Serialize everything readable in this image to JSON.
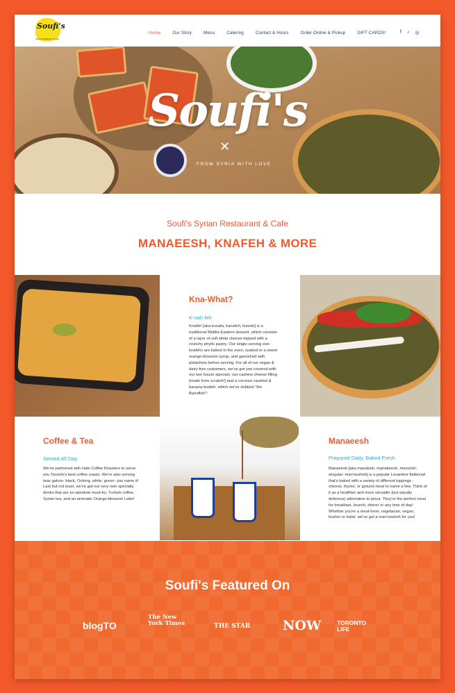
{
  "nav": {
    "logo_text": "Soufi's",
    "logo_sub": "Syrian Restaurant & Cafe",
    "items": [
      "Home",
      "Our Story",
      "Menu",
      "Catering",
      "Contact & Hours",
      "Order Online & Pickup",
      "GIFT CARDS!"
    ],
    "active": "Home",
    "social": [
      "f",
      "♪",
      "◎"
    ]
  },
  "hero": {
    "title": "Soufi's",
    "cross": "✕",
    "subtitle": "FROM SYRIA WITH LOVE"
  },
  "intro": {
    "subtitle": "Soufi's Syrian Restaurant & Cafe",
    "title": "MANAEESH, KNAFEH & MORE"
  },
  "knafeh": {
    "title": "Kna-What?",
    "subtitle": "K-nah-feh",
    "body": "Knafeh [aka kunafa, kanafeh, kunefe] is a traditional Middle-Eastern dessert, which consists of a layer of soft white cheese topped with a crunchy phyllo pastry. Our single-serving size knafehs are baked in the oven, soaked in a sweet orange-blossom syrup, and garnished with pistachios before serving. For all of our vegan & dairy-free customers, we've got you covered with our two house specials: our cashew cheese filling [made from scratch!] and a coconut caramel & banana knafeh, which we've dubbed \"the Banoffeh\"!"
  },
  "coffee": {
    "title": "Coffee & Tea",
    "subtitle": "Served All Day",
    "body": "We've partnered with Hale Coffee Roasters to serve you Toronto's best coffee roasts. We're also serving teas galore- black, Oolong, white, green- you name it! Last but not least, we've got our very own specialty drinks that are an absolute must-try: Turkish coffee, Syrian tea, and an aromatic Orange-blossom Latte!"
  },
  "manaeesh": {
    "title": "Manaeesh",
    "subtitle": "Prepared Daily, Baked Fresh",
    "body": "Manaeesh [aka manakish, manakeesh, mana'ish; singular: man'oosheh] is a popular Levantine flatbread that's baked with a variety of different toppings - cheese, thyme, or ground meat to name a few. Think of it as a healthier and more versatile (but equally delicious) alternative to pizza. They're the perfect meal for breakfast, brunch, dinner or any time of day! Whether you're a meat-lover, vegetarian, vegan, kosher or halal- we've got a man'oosheh for you!"
  },
  "featured": {
    "title": "Soufi's Featured On",
    "press": [
      "blogTO",
      "The New York Times",
      "THE STAR",
      "NOW",
      "TORONTO LIFE"
    ]
  },
  "colors": {
    "accent": "#f3592a",
    "link": "#29a9d8",
    "nav_text": "#2a3b6b"
  }
}
